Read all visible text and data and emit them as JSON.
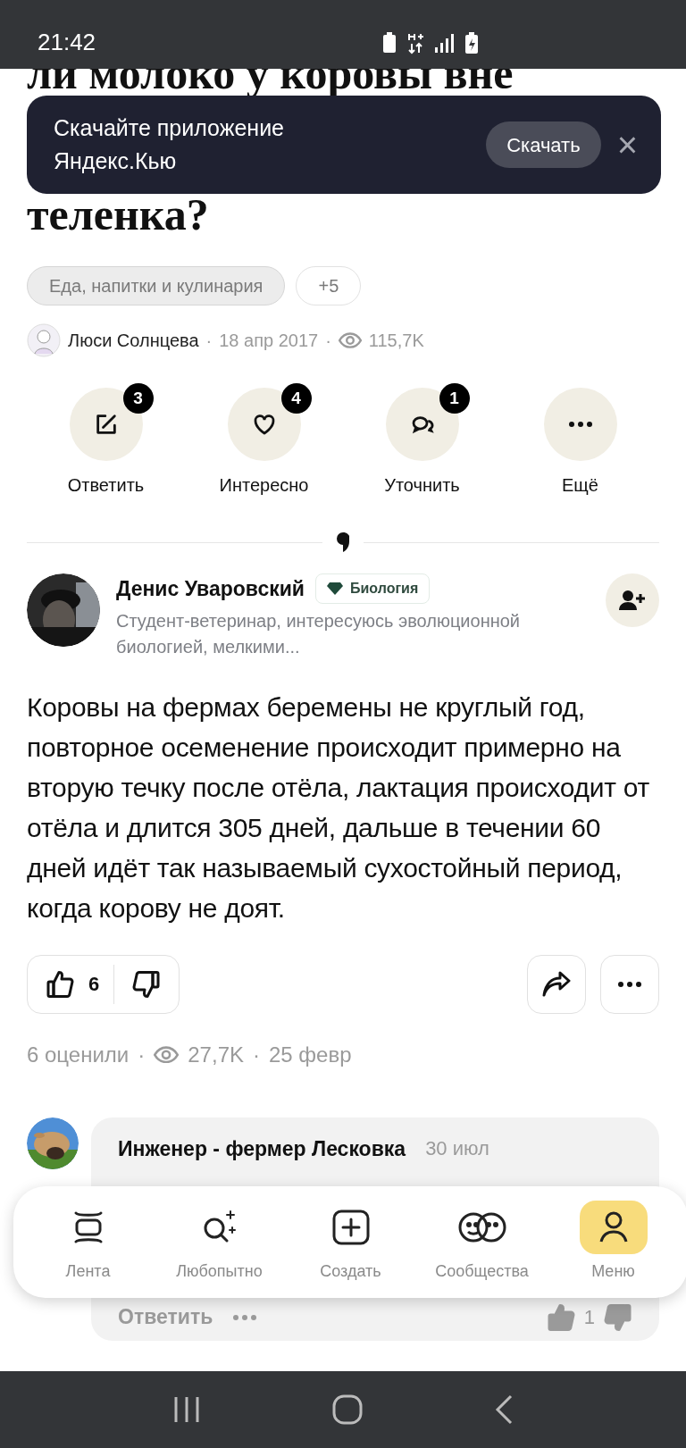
{
  "status_bar": {
    "time": "21:42"
  },
  "question": {
    "title_lines": [
      "ли молоко у коровы вне",
      "теленка?"
    ],
    "tags": [
      {
        "label": "Еда, напитки и кулинария",
        "kind": "topic"
      },
      {
        "label": "+5",
        "kind": "more"
      }
    ],
    "author": "Люси Солнцева",
    "separators": [
      "·",
      "·"
    ],
    "date": "18 апр 2017",
    "views": "115,7K",
    "actions": [
      {
        "kind": "answer",
        "label": "Ответить",
        "count": "3"
      },
      {
        "kind": "interesting",
        "label": "Интересно",
        "count": "4"
      },
      {
        "kind": "clarify",
        "label": "Уточнить",
        "count": "1"
      },
      {
        "kind": "more",
        "label": "Ещё"
      }
    ]
  },
  "banner": {
    "text_lines": [
      "Скачайте приложение",
      "Яндекс.Кью"
    ],
    "button": "Скачать",
    "close": "×"
  },
  "answer": {
    "author": "Денис Уваровский",
    "badge": "Биология",
    "bio": "Студент-ветеринар, интересуюсь эволюционной биологией, мелкими...",
    "text": "Коровы на фермах беремены не круглый год, повторное осеменение происходит примерно на вторую течку после отёла, лактация происходит от отёла и длится 305 дней, дальше в течении 60 дней идёт так называемый сухостойный период, когда корову не доят.",
    "likes": "6",
    "rated": "6 оценили",
    "separators": [
      "·",
      "·"
    ],
    "views": "27,7K",
    "date": "25 февр"
  },
  "comment": {
    "author": "Инженер - фермер Лесковка",
    "date": "30 июл",
    "reply": "Ответить",
    "likes": "1"
  },
  "bottom_nav": [
    {
      "label": "Лента",
      "kind": "feed",
      "selected": false
    },
    {
      "label": "Любопытно",
      "kind": "explore",
      "selected": false
    },
    {
      "label": "Создать",
      "kind": "create",
      "selected": false
    },
    {
      "label": "Сообщества",
      "kind": "communities",
      "selected": false
    },
    {
      "label": "Меню",
      "kind": "menu",
      "selected": true
    }
  ]
}
